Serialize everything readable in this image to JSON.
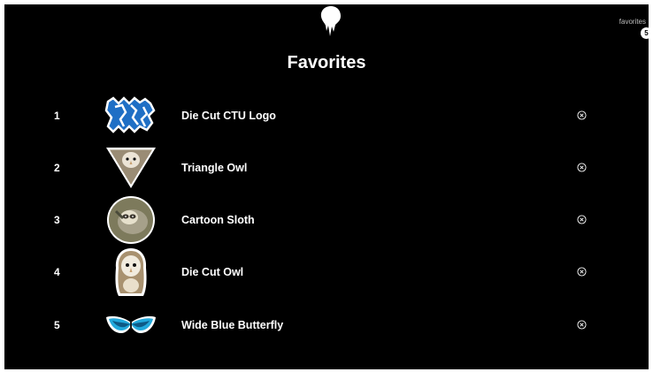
{
  "header": {
    "favorites_link": "favorites",
    "favorites_count": "5",
    "logo_icon": "slime-drip-logo-icon"
  },
  "page": {
    "title": "Favorites"
  },
  "favorites": [
    {
      "rank": "1",
      "name": "Die Cut CTU Logo",
      "thumbnail": "ctu-lion-logo-sticker",
      "remove_icon": "remove-circle-x-icon"
    },
    {
      "rank": "2",
      "name": "Triangle Owl",
      "thumbnail": "triangle-owl-sticker",
      "remove_icon": "remove-circle-x-icon"
    },
    {
      "rank": "3",
      "name": "Cartoon Sloth",
      "thumbnail": "round-sloth-sticker",
      "remove_icon": "remove-circle-x-icon"
    },
    {
      "rank": "4",
      "name": "Die Cut Owl",
      "thumbnail": "die-cut-owl-sticker",
      "remove_icon": "remove-circle-x-icon"
    },
    {
      "rank": "5",
      "name": "Wide Blue Butterfly",
      "thumbnail": "blue-butterfly-sticker",
      "remove_icon": "remove-circle-x-icon"
    }
  ],
  "colors": {
    "background": "#000000",
    "text": "#ffffff",
    "muted": "#bdbdbd",
    "butterfly_blue": "#22a9dc",
    "ctu_blue": "#1f6fc5"
  }
}
